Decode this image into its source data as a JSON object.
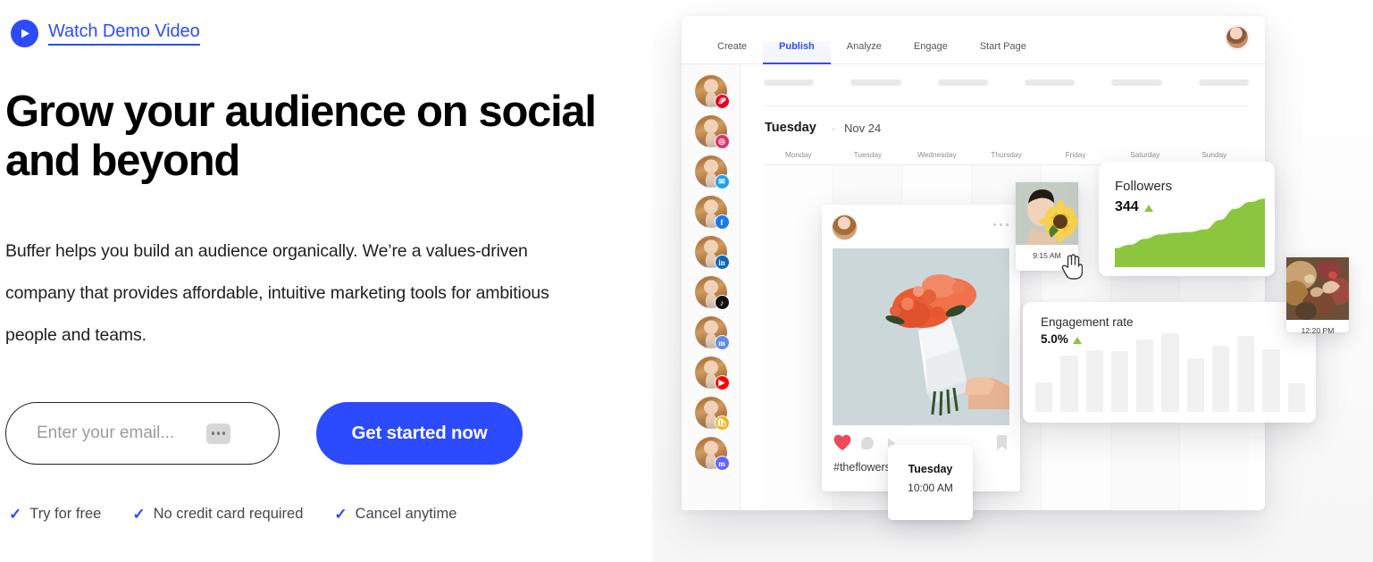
{
  "brand": {
    "blue": "#2C4BFF",
    "green": "#8CC63F",
    "heart_red": "#ED4956"
  },
  "hero": {
    "demo_link": "Watch Demo Video",
    "headline": "Grow your audience on social and beyond",
    "subhead": "Buffer helps you build an audience organically. We’re a values-driven company that provides affordable, intuitive marketing tools for ambitious people and teams.",
    "email": {
      "placeholder": "Enter your email...",
      "value": ""
    },
    "cta_label": "Get started now",
    "perks": [
      {
        "check": "✓",
        "label": "Try for free"
      },
      {
        "check": "✓",
        "label": "No credit card required"
      },
      {
        "check": "✓",
        "label": "Cancel anytime"
      }
    ]
  },
  "app": {
    "tabs": [
      {
        "label": "Create",
        "active": false
      },
      {
        "label": "Publish",
        "active": true
      },
      {
        "label": "Analyze",
        "active": false
      },
      {
        "label": "Engage",
        "active": false
      },
      {
        "label": "Start Page",
        "active": false
      }
    ],
    "sidebar_channels": [
      {
        "name": "pinterest",
        "glyph": "𝓟",
        "color": "#E60023"
      },
      {
        "name": "instagram",
        "glyph": "◎",
        "color": "#E1306C"
      },
      {
        "name": "twitter",
        "glyph": "✉",
        "color": "#1DA1F2"
      },
      {
        "name": "facebook",
        "glyph": "f",
        "color": "#1877F2"
      },
      {
        "name": "linkedin",
        "glyph": "in",
        "color": "#0A66C2"
      },
      {
        "name": "tiktok",
        "glyph": "♪",
        "color": "#111111"
      },
      {
        "name": "mastodon",
        "glyph": "m",
        "color": "#5D8BE8"
      },
      {
        "name": "youtube",
        "glyph": "▶",
        "color": "#FF0000"
      },
      {
        "name": "shopify",
        "glyph": "🛍",
        "color": "#E8B923"
      },
      {
        "name": "mastodon-alt",
        "glyph": "m",
        "color": "#6364FF"
      }
    ],
    "calendar": {
      "day_title": "Tuesday",
      "separator": "·",
      "date": "Nov 24",
      "weekdays": [
        "Monday",
        "Tuesday",
        "Wednesday",
        "Thursday",
        "Friday",
        "Saturday",
        "Sunday"
      ]
    },
    "post_card": {
      "caption": "#theflowershop"
    },
    "tooltip": {
      "day": "Tuesday",
      "time": "10:00 AM"
    },
    "thumbnails": [
      {
        "name": "sunflower-post",
        "time": "9:15 AM"
      },
      {
        "name": "flowers-post",
        "time": "12:20 PM"
      }
    ]
  },
  "chart_data": [
    {
      "type": "area",
      "title": "Followers",
      "value_label": "344",
      "trend": "up",
      "x": [
        0,
        1,
        2,
        3,
        4,
        5,
        6,
        7,
        8,
        9,
        10
      ],
      "values": [
        22,
        26,
        33,
        38,
        40,
        41,
        44,
        55,
        68,
        76,
        80
      ],
      "ylim": [
        0,
        100
      ],
      "grid": false,
      "legend": "none",
      "color": "#8CC63F"
    },
    {
      "type": "bar",
      "title": "Engagement rate",
      "value_label": "5.0%",
      "trend": "up",
      "categories": [
        "1",
        "2",
        "3",
        "4",
        "5",
        "6",
        "7",
        "8",
        "9",
        "10",
        "11"
      ],
      "values": [
        38,
        72,
        78,
        77,
        92,
        100,
        68,
        84,
        97,
        80,
        36
      ],
      "ylim": [
        0,
        100
      ],
      "grid": false,
      "legend": "none",
      "color": "#F1F1F1"
    }
  ]
}
